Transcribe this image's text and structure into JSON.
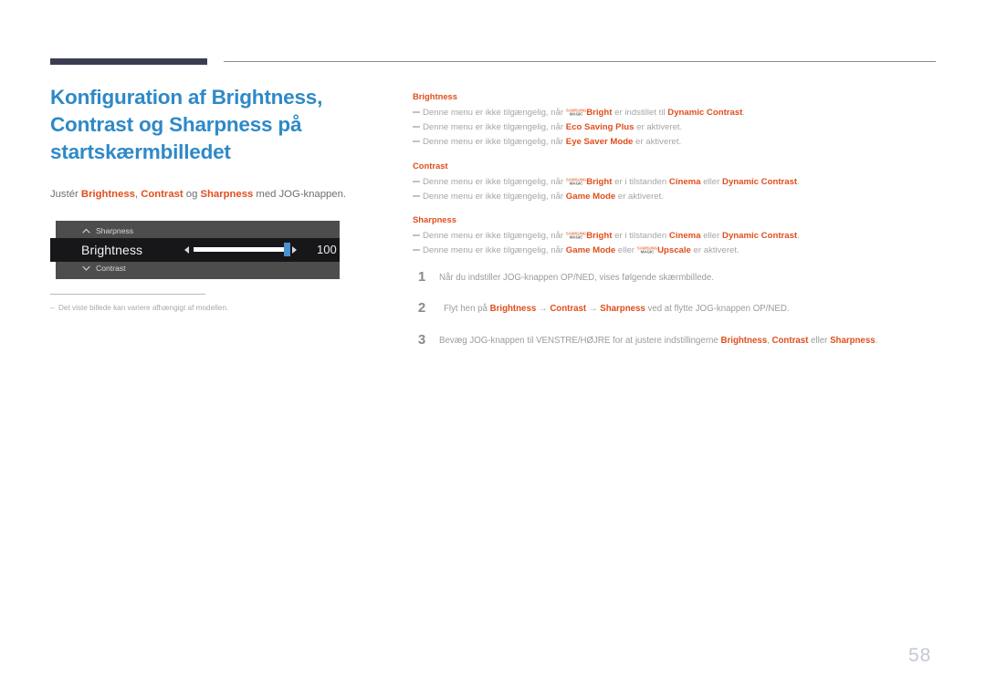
{
  "header": {
    "rule_thick_color": "#3d3d52",
    "rule_thin_color": "#8d8d8d"
  },
  "left": {
    "title": "Konfiguration af Brightness, Contrast og Sharpness på startskærmbilledet",
    "title_color": "#2e89c8",
    "intro": {
      "pre": "Justér ",
      "term1": "Brightness",
      "sep1": ", ",
      "term2": "Contrast",
      "sep2": " og ",
      "term3": "Sharpness",
      "post": " med JOG-knappen."
    },
    "osd": {
      "row_top_label": "Sharpness",
      "row_top_icon": "chevron-up-icon",
      "selected_label": "Brightness",
      "selected_value": "100",
      "row_bottom_label": "Contrast",
      "row_bottom_icon": "chevron-down-icon",
      "panel_color": "#4d4d4d",
      "selected_row_color": "#17171a",
      "knob_color": "#4a90d0",
      "track_color": "#ffffff"
    },
    "footnote": {
      "dash": "‒",
      "text": "Det viste billede kan variere afhængigt af modellen."
    }
  },
  "right": {
    "accent_color": "#e04e1c",
    "sections": [
      {
        "heading": "Brightness",
        "notes": [
          {
            "p1": "Denne menu er ikke tilgængelig, når ",
            "logo": true,
            "b1": "Bright",
            "p2": " er indstillet til ",
            "b2": "Dynamic Contrast",
            "p3": "."
          },
          {
            "p1": "Denne menu er ikke tilgængelig, når ",
            "logo": false,
            "b1": "Eco Saving Plus",
            "p2": " er aktiveret.",
            "b2": "",
            "p3": ""
          },
          {
            "p1": "Denne menu er ikke tilgængelig, når ",
            "logo": false,
            "b1": "Eye Saver Mode",
            "p2": " er aktiveret.",
            "b2": "",
            "p3": ""
          }
        ]
      },
      {
        "heading": "Contrast",
        "notes": [
          {
            "p1": "Denne menu er ikke tilgængelig, når ",
            "logo": true,
            "b1": "Bright",
            "p2": " er i tilstanden ",
            "b2": "Cinema",
            "p2b": " eller ",
            "b3": "Dynamic Contrast",
            "p3": "."
          },
          {
            "p1": "Denne menu er ikke tilgængelig, når ",
            "logo": false,
            "b1": "Game Mode",
            "p2": " er aktiveret.",
            "b2": "",
            "p3": ""
          }
        ]
      },
      {
        "heading": "Sharpness",
        "notes": [
          {
            "p1": "Denne menu er ikke tilgængelig, når ",
            "logo": true,
            "b1": "Bright",
            "p2": " er i tilstanden ",
            "b2": "Cinema",
            "p2b": " eller ",
            "b3": "Dynamic Contrast",
            "p3": "."
          },
          {
            "p1": "Denne menu er ikke tilgængelig, når ",
            "logo": false,
            "b1": "Game Mode",
            "p2": " eller ",
            "logo2": true,
            "b2": "Upscale",
            "p3": " er aktiveret."
          }
        ]
      }
    ],
    "logo": {
      "line1": "SAMSUNG",
      "line2": "MAGIC"
    },
    "steps": [
      {
        "num": "1",
        "p1": "Når du indstiller JOG-knappen OP/NED, vises følgende skærmbillede."
      },
      {
        "num": "2",
        "p1": "Flyt hen på ",
        "b1": "Brightness",
        "p2": " → ",
        "b2": "Contrast",
        "p3": " → ",
        "b3": "Sharpness",
        "p4": " ved at flytte JOG-knappen OP/NED."
      },
      {
        "num": "3",
        "p1": "Bevæg JOG-knappen til VENSTRE/HØJRE for at justere indstillingerne ",
        "b1": "Brightness",
        "p2": ", ",
        "b2": "Contrast",
        "p3": " eller ",
        "b3": "Sharpness",
        "p4": "."
      }
    ]
  },
  "page_number": "58"
}
